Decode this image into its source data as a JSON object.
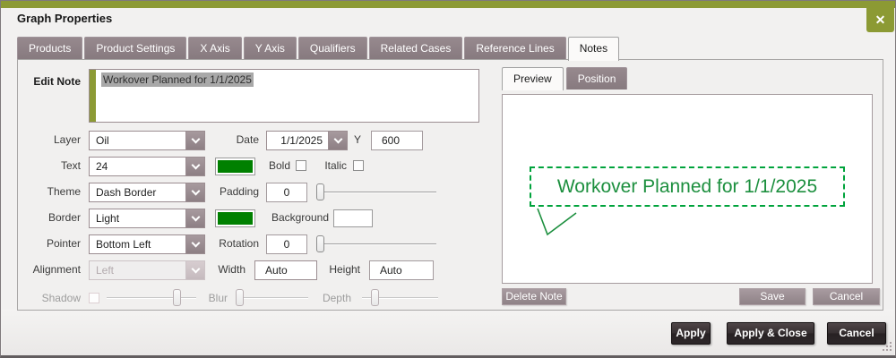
{
  "dialog": {
    "title": "Graph Properties",
    "close_glyph": "✕"
  },
  "tabs": [
    {
      "label": "Products"
    },
    {
      "label": "Product Settings"
    },
    {
      "label": "X Axis"
    },
    {
      "label": "Y Axis"
    },
    {
      "label": "Qualifiers"
    },
    {
      "label": "Related Cases"
    },
    {
      "label": "Reference Lines"
    },
    {
      "label": "Notes",
      "active": true
    }
  ],
  "note_form": {
    "edit_note_label": "Edit Note",
    "note_text": "Workover Planned for 1/1/2025",
    "layer_label": "Layer",
    "layer_value": "Oil",
    "date_label": "Date",
    "date_value": "1/1/2025",
    "y_label": "Y",
    "y_value": "600",
    "text_label": "Text",
    "text_value": "24",
    "text_color": "#008000",
    "bold_label": "Bold",
    "bold_checked": false,
    "italic_label": "Italic",
    "italic_checked": false,
    "theme_label": "Theme",
    "theme_value": "Dash Border",
    "padding_label": "Padding",
    "padding_value": "0",
    "padding_slider_pct": 0,
    "border_label": "Border",
    "border_value": "Light",
    "border_color": "#008000",
    "background_label": "Background",
    "background_color": "#ffffff",
    "pointer_label": "Pointer",
    "pointer_value": "Bottom Left",
    "rotation_label": "Rotation",
    "rotation_value": "0",
    "rotation_slider_pct": 0,
    "alignment_label": "Alignment",
    "alignment_value": "Left",
    "alignment_disabled": true,
    "width_label": "Width",
    "width_value": "Auto",
    "height_label": "Height",
    "height_value": "Auto",
    "shadow_label": "Shadow",
    "shadow_disabled": true,
    "shadow_slider_pct": 78,
    "blur_label": "Blur",
    "blur_slider_pct": 4,
    "depth_label": "Depth",
    "depth_slider_pct": 16
  },
  "preview_panel": {
    "tabs": [
      {
        "label": "Preview",
        "active": true
      },
      {
        "label": "Position"
      }
    ],
    "note_preview_text": "Workover Planned for 1/1/2025",
    "delete_button": "Delete Note",
    "save_button": "Save",
    "cancel_button": "Cancel"
  },
  "footer": {
    "apply": "Apply",
    "apply_and_close": "Apply & Close",
    "cancel": "Cancel"
  },
  "theme_colors": {
    "accent_olive": "#8c9a34",
    "tab_mauve": "#8d7f84",
    "preview_green": "#00a33c",
    "dark_button": "#2d2729"
  }
}
